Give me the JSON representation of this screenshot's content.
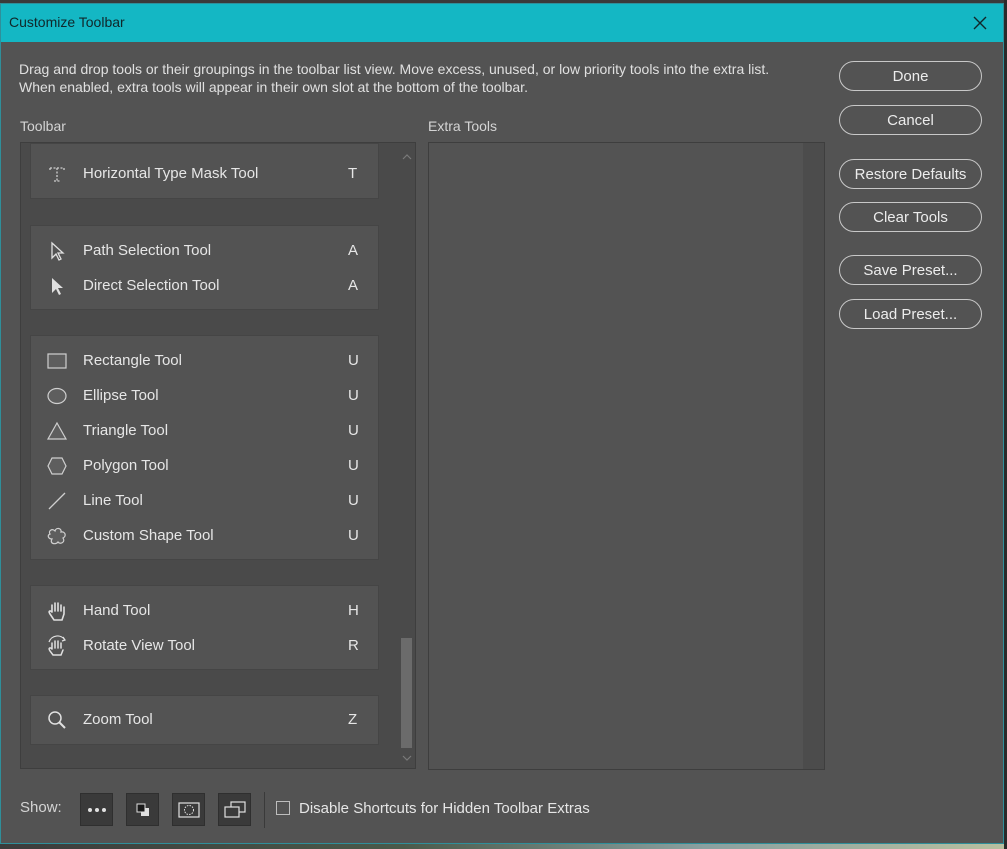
{
  "window": {
    "title": "Customize Toolbar"
  },
  "description": "Drag and drop tools or their groupings in the toolbar list view. Move excess, unused, or low priority tools into the extra list. When enabled, extra tools will appear in their own slot at the bottom of the toolbar.",
  "toolbar_label": "Toolbar",
  "extra_label": "Extra Tools",
  "groups": [
    {
      "tools": [
        {
          "name": "Horizontal Type Mask Tool",
          "shortcut": "T",
          "icon": "type-mask-icon"
        }
      ]
    },
    {
      "tools": [
        {
          "name": "Path Selection Tool",
          "shortcut": "A",
          "icon": "path-selection-icon"
        },
        {
          "name": "Direct Selection Tool",
          "shortcut": "A",
          "icon": "direct-selection-icon"
        }
      ]
    },
    {
      "tools": [
        {
          "name": "Rectangle Tool",
          "shortcut": "U",
          "icon": "rectangle-icon"
        },
        {
          "name": "Ellipse Tool",
          "shortcut": "U",
          "icon": "ellipse-icon"
        },
        {
          "name": "Triangle Tool",
          "shortcut": "U",
          "icon": "triangle-icon"
        },
        {
          "name": "Polygon Tool",
          "shortcut": "U",
          "icon": "polygon-icon"
        },
        {
          "name": "Line Tool",
          "shortcut": "U",
          "icon": "line-icon"
        },
        {
          "name": "Custom Shape Tool",
          "shortcut": "U",
          "icon": "custom-shape-icon"
        }
      ]
    },
    {
      "tools": [
        {
          "name": "Hand Tool",
          "shortcut": "H",
          "icon": "hand-icon"
        },
        {
          "name": "Rotate View Tool",
          "shortcut": "R",
          "icon": "rotate-view-icon"
        }
      ]
    },
    {
      "tools": [
        {
          "name": "Zoom Tool",
          "shortcut": "Z",
          "icon": "zoom-icon"
        }
      ]
    }
  ],
  "buttons": {
    "done": "Done",
    "cancel": "Cancel",
    "restore_defaults": "Restore Defaults",
    "clear_tools": "Clear Tools",
    "save_preset": "Save Preset...",
    "load_preset": "Load Preset..."
  },
  "show": {
    "label": "Show:",
    "options": [
      "more-tools-icon",
      "color-swatches-icon",
      "quick-mask-icon",
      "screen-mode-icon"
    ]
  },
  "disable_shortcuts": {
    "label": "Disable Shortcuts for Hidden Toolbar Extras",
    "checked": false
  }
}
